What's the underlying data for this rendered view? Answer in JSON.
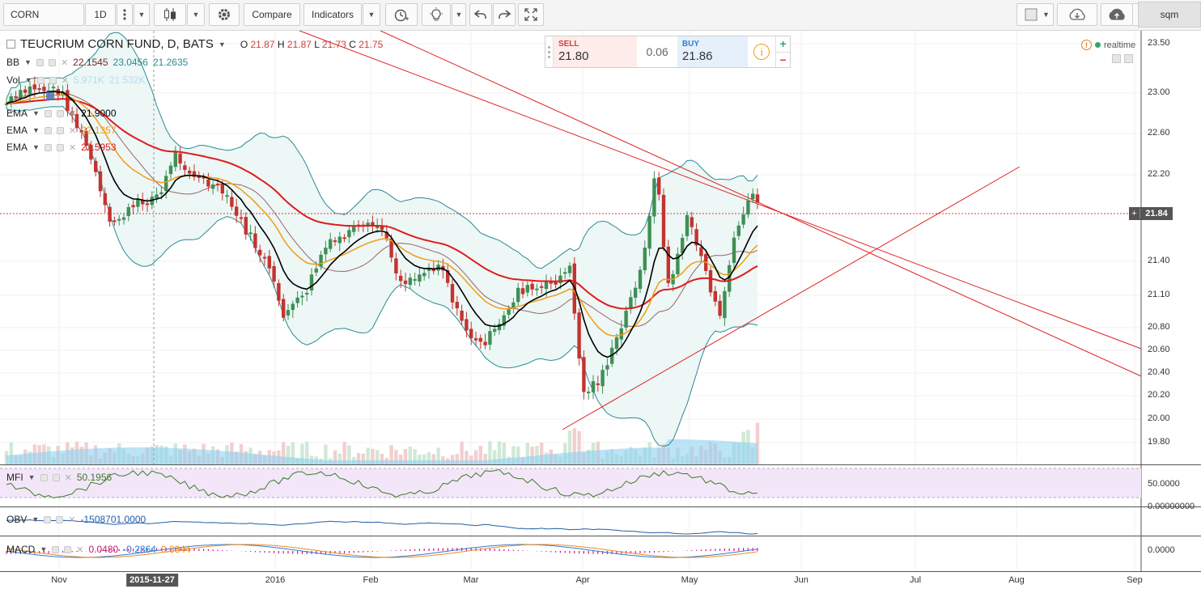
{
  "toolbar": {
    "symbol": "CORN",
    "interval": "1D",
    "compare_label": "Compare",
    "indicators_label": "Indicators",
    "user": "sqm"
  },
  "legend": {
    "title": "TEUCRIUM CORN FUND, D, BATS",
    "o_label": "O",
    "o": "21.87",
    "h_label": "H",
    "h": "21.87",
    "l_label": "L",
    "l": "21.73",
    "c_label": "C",
    "c": "21.75",
    "bb_name": "BB",
    "bb_v1": "22.1545",
    "bb_v2": "23.0456",
    "bb_v3": "21.2635",
    "vol_name": "Vol",
    "vol_v1": "5.971K",
    "vol_v2": "21.532K",
    "ema1_name": "EMA",
    "ema1_v": "21.9000",
    "ema2_name": "EMA",
    "ema2_v": "22.1357",
    "ema3_name": "EMA",
    "ema3_v": "22.5953",
    "mfi_name": "MFI",
    "mfi_v": "50.1956",
    "obv_name": "OBV",
    "obv_v": "-1508701.0000",
    "macd_name": "MACD",
    "macd_v1": "0.0480",
    "macd_v2": "-0.2864",
    "macd_v3": "0.3344"
  },
  "trade": {
    "sell_label": "SELL",
    "sell_price": "21.80",
    "spread": "0.06",
    "buy_label": "BUY",
    "buy_price": "21.86",
    "plus": "+",
    "minus": "−"
  },
  "realtime_label": "realtime",
  "price_axis": {
    "ticks": [
      "23.50",
      "23.00",
      "22.60",
      "22.20",
      "21.40",
      "21.10",
      "20.80",
      "20.60",
      "20.40",
      "20.20",
      "20.00",
      "19.80"
    ],
    "current": "21.84",
    "current_plus": "+",
    "mfi_tick": "50.0000",
    "obv_tick": "0.00000000",
    "macd_tick": "0.0000"
  },
  "time_axis": {
    "labels": [
      "Nov",
      "2016",
      "Feb",
      "Mar",
      "Apr",
      "May",
      "Jun",
      "Jul",
      "Aug",
      "Sep"
    ],
    "highlight": "2015-11-27"
  },
  "colors": {
    "up": "#3f8f55",
    "down": "#c4332f",
    "bb": "#2c8a93",
    "ema_fast": "#000000",
    "ema_mid": "#f39c12",
    "ema_slow": "#e01b1b",
    "trend": "#e02020",
    "mfi_fill": "#f3e6f8",
    "obv": "#1f5fa8",
    "vol_ma": "#7ec8ec"
  }
}
